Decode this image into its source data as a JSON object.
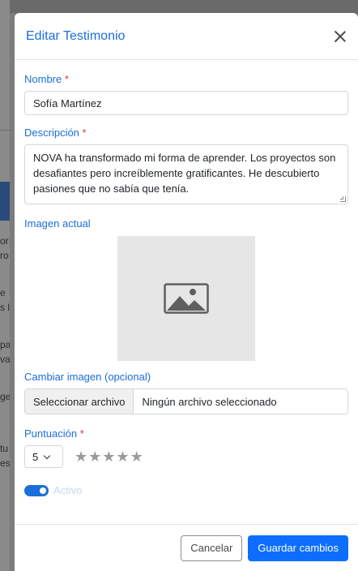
{
  "background": {
    "fragments": [
      "or",
      "ro",
      "e",
      "s l",
      "pa",
      "va",
      "ge",
      "tu",
      "es"
    ]
  },
  "modal": {
    "title": "Editar Testimonio",
    "fields": {
      "name": {
        "label": "Nombre",
        "required_mark": "*",
        "value": "Sofía Martínez"
      },
      "description": {
        "label": "Descripción",
        "required_mark": "*",
        "value": "NOVA ha transformado mi forma de aprender. Los proyectos son desafiantes pero increíblemente gratificantes. He descubierto pasiones que no sabía que tenía."
      },
      "current_image": {
        "label": "Imagen actual",
        "icon": "image-placeholder-icon"
      },
      "change_image": {
        "label": "Cambiar imagen (opcional)",
        "button_label": "Seleccionar archivo",
        "file_status": "Ningún archivo seleccionado"
      },
      "rating": {
        "label": "Puntuación",
        "required_mark": "*",
        "selected": "5",
        "stars_filled": 5,
        "stars_total": 5,
        "star_color": "#9a9a9a"
      },
      "active": {
        "label": "Activo",
        "checked": true
      }
    },
    "footer": {
      "cancel_label": "Cancelar",
      "save_label": "Guardar cambios"
    }
  },
  "colors": {
    "accent": "#1a6fd8",
    "primary_button": "#0d6efd",
    "required": "#dc3545"
  }
}
